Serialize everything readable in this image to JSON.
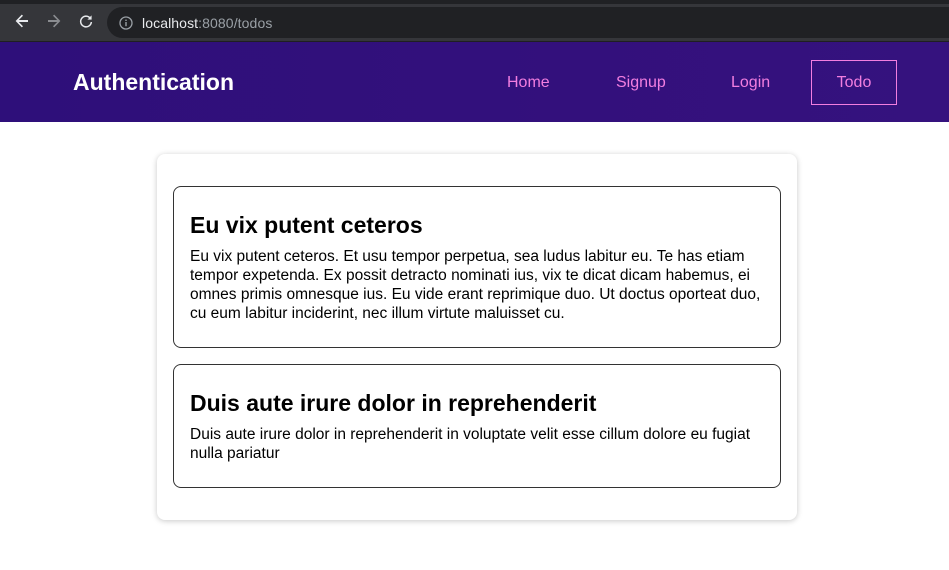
{
  "browser": {
    "url_host": "localhost",
    "url_path": ":8080/todos"
  },
  "header": {
    "brand": "Authentication",
    "nav": {
      "home": "Home",
      "signup": "Signup",
      "login": "Login",
      "todo": "Todo"
    },
    "colors": {
      "background": "#33107c",
      "link": "#f27ee0"
    }
  },
  "todos": [
    {
      "title": "Eu vix putent ceteros",
      "body": "Eu vix putent ceteros. Et usu tempor perpetua, sea ludus labitur eu. Te has etiam tempor expetenda. Ex possit detracto nominati ius, vix te dicat dicam habemus, ei omnes primis omnesque ius. Eu vide erant reprimique duo. Ut doctus oporteat duo, cu eum labitur inciderint, nec illum virtute maluisset cu."
    },
    {
      "title": "Duis aute irure dolor in reprehenderit",
      "body": "Duis aute irure dolor in reprehenderit in voluptate velit esse cillum dolore eu fugiat nulla pariatur"
    }
  ],
  "icons": {
    "back": "arrow-left-icon",
    "forward": "arrow-right-icon",
    "reload": "reload-icon",
    "info": "info-icon"
  }
}
